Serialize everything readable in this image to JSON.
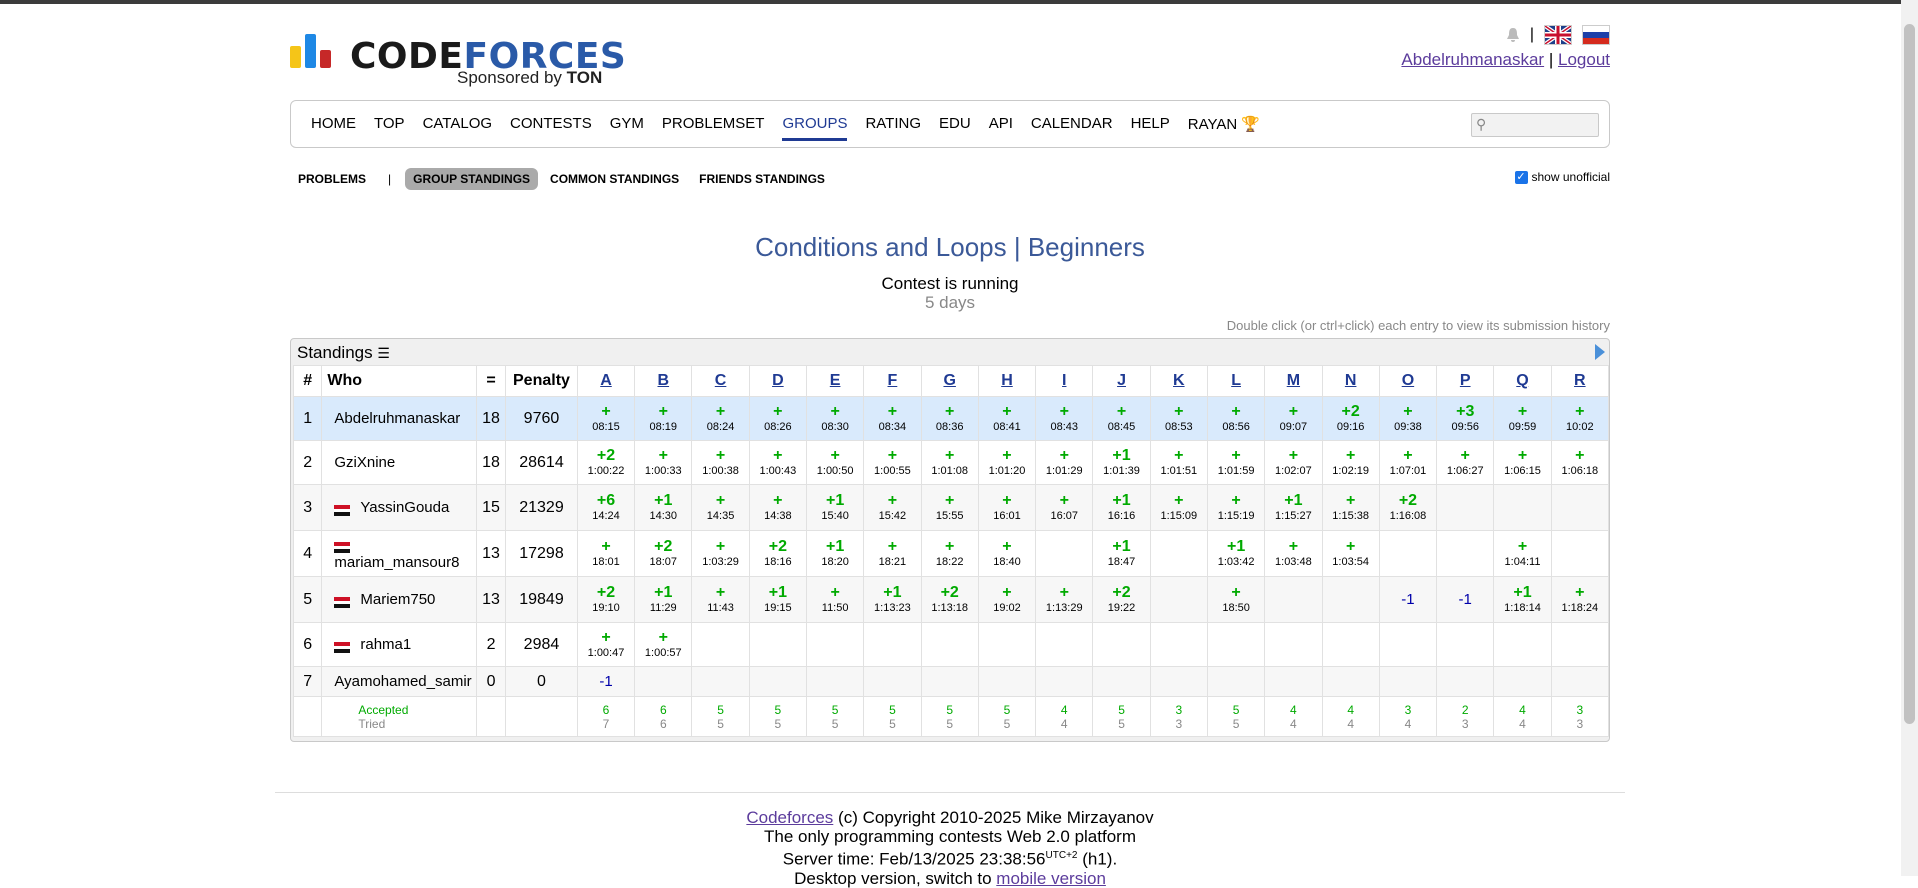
{
  "brand": {
    "name_first": "CODE",
    "name_second": "FORCES",
    "sponsor_text": "Sponsored by",
    "sponsor_name": "TON",
    "colors": {
      "bar1": "#f5c518",
      "bar2": "#1e88e5",
      "bar3": "#c62828",
      "accent": "#1f3a93"
    }
  },
  "header": {
    "user_link": "Abdelruhmanaskar",
    "separator": "|",
    "logout_link": "Logout"
  },
  "nav": {
    "items": [
      "HOME",
      "TOP",
      "CATALOG",
      "CONTESTS",
      "GYM",
      "PROBLEMSET",
      "GROUPS",
      "RATING",
      "EDU",
      "API",
      "CALENDAR",
      "HELP",
      "RAYAN"
    ],
    "active": "GROUPS"
  },
  "subtabs": {
    "problems": "PROBLEMS",
    "divider": "|",
    "group_standings": "GROUP STANDINGS",
    "common_standings": "COMMON STANDINGS",
    "friends_standings": "FRIENDS STANDINGS",
    "show_unofficial": "show unofficial"
  },
  "contest": {
    "title": "Conditions and Loops | Beginners",
    "status": "Contest is running",
    "remaining": "5 days",
    "hint": "Double click (or ctrl+click) each entry to view its submission history",
    "standings_label": "Standings"
  },
  "table": {
    "headers": {
      "rank": "#",
      "who": "Who",
      "solved": "=",
      "penalty": "Penalty"
    },
    "problems": [
      "A",
      "B",
      "C",
      "D",
      "E",
      "F",
      "G",
      "H",
      "I",
      "J",
      "K",
      "L",
      "M",
      "N",
      "O",
      "P",
      "Q",
      "R"
    ],
    "rows": [
      {
        "rank": "1",
        "who": "Abdelruhmanaskar",
        "flag": false,
        "solved": "18",
        "penalty": "9760",
        "cells": [
          [
            "+",
            "08:15"
          ],
          [
            "+",
            "08:19"
          ],
          [
            "+",
            "08:24"
          ],
          [
            "+",
            "08:26"
          ],
          [
            "+",
            "08:30"
          ],
          [
            "+",
            "08:34"
          ],
          [
            "+",
            "08:36"
          ],
          [
            "+",
            "08:41"
          ],
          [
            "+",
            "08:43"
          ],
          [
            "+",
            "08:45"
          ],
          [
            "+",
            "08:53"
          ],
          [
            "+",
            "08:56"
          ],
          [
            "+",
            "09:07"
          ],
          [
            "+2",
            "09:16"
          ],
          [
            "+",
            "09:38"
          ],
          [
            "+3",
            "09:56"
          ],
          [
            "+",
            "09:59"
          ],
          [
            "+",
            "10:02"
          ]
        ]
      },
      {
        "rank": "2",
        "who": "GziXnine",
        "flag": false,
        "solved": "18",
        "penalty": "28614",
        "cells": [
          [
            "+2",
            "1:00:22"
          ],
          [
            "+",
            "1:00:33"
          ],
          [
            "+",
            "1:00:38"
          ],
          [
            "+",
            "1:00:43"
          ],
          [
            "+",
            "1:00:50"
          ],
          [
            "+",
            "1:00:55"
          ],
          [
            "+",
            "1:01:08"
          ],
          [
            "+",
            "1:01:20"
          ],
          [
            "+",
            "1:01:29"
          ],
          [
            "+1",
            "1:01:39"
          ],
          [
            "+",
            "1:01:51"
          ],
          [
            "+",
            "1:01:59"
          ],
          [
            "+",
            "1:02:07"
          ],
          [
            "+",
            "1:02:19"
          ],
          [
            "+",
            "1:07:01"
          ],
          [
            "+",
            "1:06:27"
          ],
          [
            "+",
            "1:06:15"
          ],
          [
            "+",
            "1:06:18"
          ]
        ]
      },
      {
        "rank": "3",
        "who": "YassinGouda",
        "flag": true,
        "solved": "15",
        "penalty": "21329",
        "cells": [
          [
            "+6",
            "14:24"
          ],
          [
            "+1",
            "14:30"
          ],
          [
            "+",
            "14:35"
          ],
          [
            "+",
            "14:38"
          ],
          [
            "+1",
            "15:40"
          ],
          [
            "+",
            "15:42"
          ],
          [
            "+",
            "15:55"
          ],
          [
            "+",
            "16:01"
          ],
          [
            "+",
            "16:07"
          ],
          [
            "+1",
            "16:16"
          ],
          [
            "+",
            "1:15:09"
          ],
          [
            "+",
            "1:15:19"
          ],
          [
            "+1",
            "1:15:27"
          ],
          [
            "+",
            "1:15:38"
          ],
          [
            "+2",
            "1:16:08"
          ],
          [
            "",
            ""
          ],
          [
            "",
            ""
          ],
          [
            "",
            ""
          ]
        ]
      },
      {
        "rank": "4",
        "who": "mariam_mansour8",
        "flag": true,
        "solved": "13",
        "penalty": "17298",
        "cells": [
          [
            "+",
            "18:01"
          ],
          [
            "+2",
            "18:07"
          ],
          [
            "+",
            "1:03:29"
          ],
          [
            "+2",
            "18:16"
          ],
          [
            "+1",
            "18:20"
          ],
          [
            "+",
            "18:21"
          ],
          [
            "+",
            "18:22"
          ],
          [
            "+",
            "18:40"
          ],
          [
            "",
            ""
          ],
          [
            "+1",
            "18:47"
          ],
          [
            "",
            ""
          ],
          [
            "+1",
            "1:03:42"
          ],
          [
            "+",
            "1:03:48"
          ],
          [
            "+",
            "1:03:54"
          ],
          [
            "",
            ""
          ],
          [
            "",
            ""
          ],
          [
            "+",
            "1:04:11"
          ],
          [
            "",
            ""
          ]
        ]
      },
      {
        "rank": "5",
        "who": "Mariem750",
        "flag": true,
        "solved": "13",
        "penalty": "19849",
        "cells": [
          [
            "+2",
            "19:10"
          ],
          [
            "+1",
            "11:29"
          ],
          [
            "+",
            "11:43"
          ],
          [
            "+1",
            "19:15"
          ],
          [
            "+",
            "11:50"
          ],
          [
            "+1",
            "1:13:23"
          ],
          [
            "+2",
            "1:13:18"
          ],
          [
            "+",
            "19:02"
          ],
          [
            "+",
            "1:13:29"
          ],
          [
            "+2",
            "19:22"
          ],
          [
            "",
            ""
          ],
          [
            "+",
            "18:50"
          ],
          [
            "",
            ""
          ],
          [
            "",
            ""
          ],
          [
            "-1",
            ""
          ],
          [
            "-1",
            ""
          ],
          [
            "+1",
            "1:18:14"
          ],
          [
            "+",
            "1:18:24"
          ]
        ]
      },
      {
        "rank": "6",
        "who": "rahma1",
        "flag": true,
        "solved": "2",
        "penalty": "2984",
        "cells": [
          [
            "+",
            "1:00:47"
          ],
          [
            "+",
            "1:00:57"
          ],
          [
            "",
            ""
          ],
          [
            "",
            ""
          ],
          [
            "",
            ""
          ],
          [
            "",
            ""
          ],
          [
            "",
            ""
          ],
          [
            "",
            ""
          ],
          [
            "",
            ""
          ],
          [
            "",
            ""
          ],
          [
            "",
            ""
          ],
          [
            "",
            ""
          ],
          [
            "",
            ""
          ],
          [
            "",
            ""
          ],
          [
            "",
            ""
          ],
          [
            "",
            ""
          ],
          [
            "",
            ""
          ],
          [
            "",
            ""
          ]
        ]
      },
      {
        "rank": "7",
        "who": "Ayamohamed_samir",
        "flag": false,
        "solved": "0",
        "penalty": "0",
        "cells": [
          [
            "-1",
            ""
          ],
          [
            "",
            ""
          ],
          [
            "",
            ""
          ],
          [
            "",
            ""
          ],
          [
            "",
            ""
          ],
          [
            "",
            ""
          ],
          [
            "",
            ""
          ],
          [
            "",
            ""
          ],
          [
            "",
            ""
          ],
          [
            "",
            ""
          ],
          [
            "",
            ""
          ],
          [
            "",
            ""
          ],
          [
            "",
            ""
          ],
          [
            "",
            ""
          ],
          [
            "",
            ""
          ],
          [
            "",
            ""
          ],
          [
            "",
            ""
          ],
          [
            "",
            ""
          ]
        ]
      }
    ],
    "accepted_label": "Accepted",
    "tried_label": "Tried",
    "accepted": [
      "6",
      "6",
      "5",
      "5",
      "5",
      "5",
      "5",
      "5",
      "4",
      "5",
      "3",
      "5",
      "4",
      "4",
      "3",
      "2",
      "4",
      "3"
    ],
    "tried": [
      "7",
      "6",
      "5",
      "5",
      "5",
      "5",
      "5",
      "5",
      "4",
      "5",
      "3",
      "5",
      "4",
      "4",
      "4",
      "3",
      "4",
      "3"
    ]
  },
  "footer": {
    "link": "Codeforces",
    "copyright": "(c) Copyright 2010-2025 Mike Mirzayanov",
    "tagline": "The only programming contests Web 2.0 platform",
    "server_time": "Server time: Feb/13/2025 23:38:56",
    "tz": "UTC+2",
    "host": "(h1).",
    "desktop_text": "Desktop version, switch to",
    "mobile_link": "mobile version"
  }
}
